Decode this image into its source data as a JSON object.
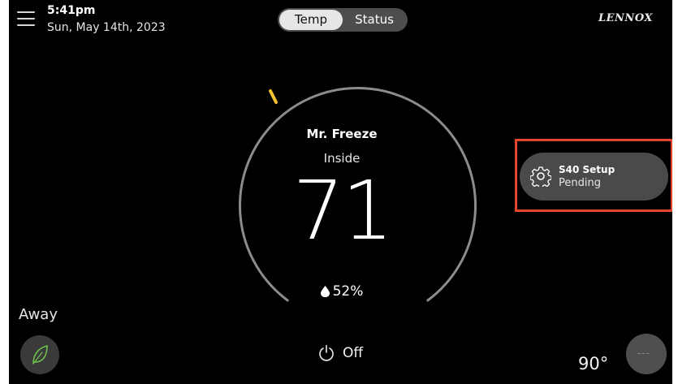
{
  "header": {
    "time": "5:41pm",
    "date": "Sun, May 14th, 2023",
    "tabs": {
      "temp": "Temp",
      "status": "Status"
    },
    "selected_tab": "Temp",
    "logo": "LENNOX"
  },
  "dial": {
    "zone_name": "Mr. Freeze",
    "location_label": "Inside",
    "temperature": "71",
    "humidity": "52%",
    "setpoint_marker_color": "#f2c230"
  },
  "setup_card": {
    "title": "S40 Setup",
    "status": "Pending",
    "highlight_color": "#e2452b"
  },
  "footer": {
    "away_label": "Away",
    "power_label": "Off",
    "outdoor_temperature": "90°",
    "fan_button_text": "---"
  },
  "icons": {
    "menu": "menu-icon",
    "gear": "gear-icon",
    "leaf": "leaf-icon",
    "power": "power-icon",
    "drop": "drop-icon"
  },
  "colors": {
    "background": "#000000",
    "leaf": "#6cc04a",
    "arc": "#8c8c8c"
  }
}
